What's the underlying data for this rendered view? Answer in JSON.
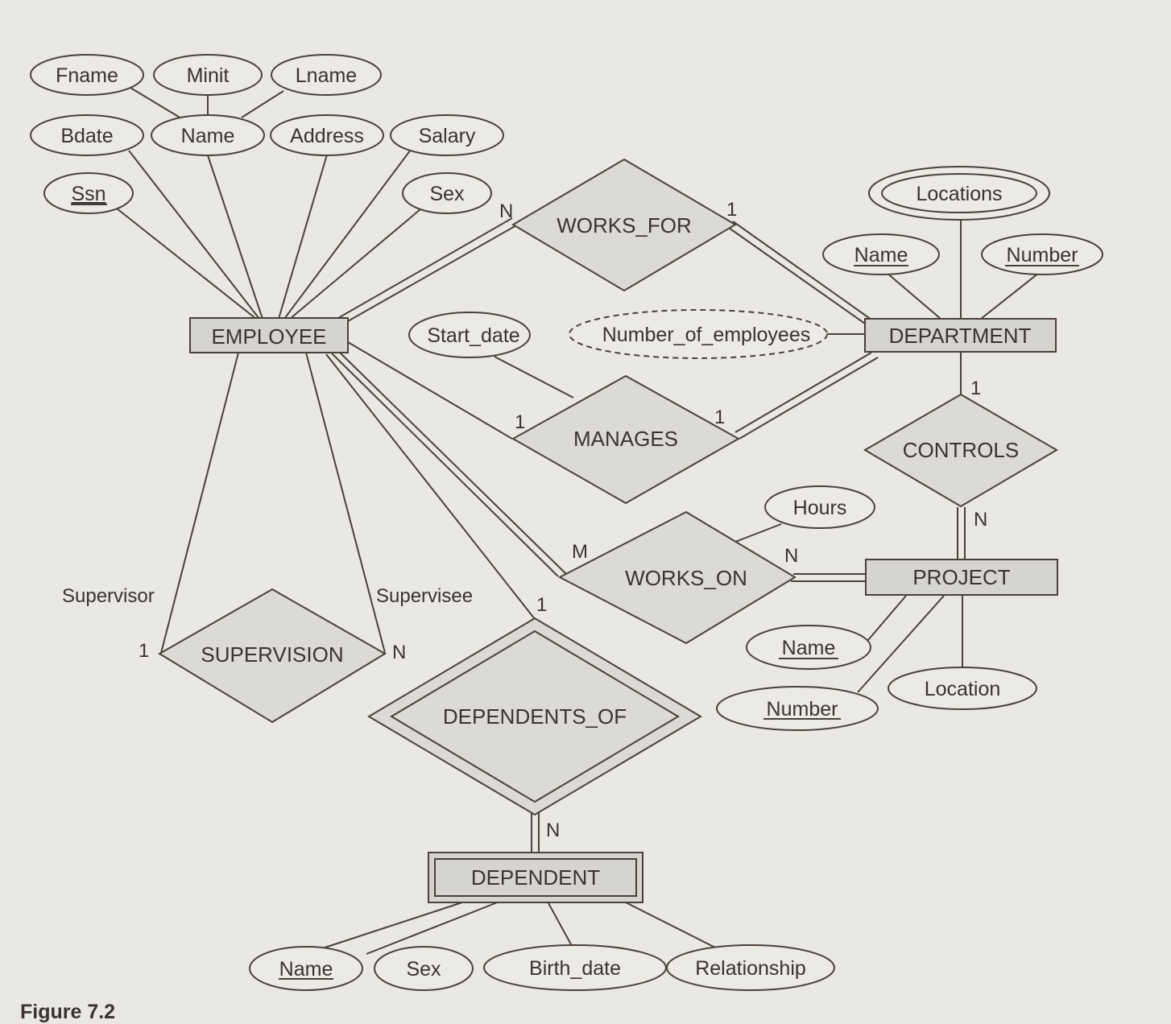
{
  "figure": {
    "caption": "Figure 7.2",
    "type": "ER diagram",
    "colors": {
      "background": "#e9e8e3",
      "ink": "#3a3330",
      "entity_fill": "#d6d4cf",
      "relationship_fill": "#dcdad5",
      "attribute_fill": "#eceae5"
    }
  },
  "entities": {
    "employee": {
      "label": "EMPLOYEE",
      "weak": false
    },
    "department": {
      "label": "DEPARTMENT",
      "weak": false
    },
    "project": {
      "label": "PROJECT",
      "weak": false
    },
    "dependent": {
      "label": "DEPENDENT",
      "weak": true
    }
  },
  "relationships": {
    "works_for": {
      "label": "WORKS_FOR",
      "identifying": false
    },
    "manages": {
      "label": "MANAGES",
      "identifying": false
    },
    "works_on": {
      "label": "WORKS_ON",
      "identifying": false
    },
    "controls": {
      "label": "CONTROLS",
      "identifying": false
    },
    "supervision": {
      "label": "SUPERVISION",
      "identifying": false
    },
    "dependents_of": {
      "label": "DEPENDENTS_OF",
      "identifying": true
    }
  },
  "attributes": {
    "employee": {
      "fname": {
        "label": "Fname",
        "key": false
      },
      "minit": {
        "label": "Minit",
        "key": false
      },
      "lname": {
        "label": "Lname",
        "key": false
      },
      "bdate": {
        "label": "Bdate",
        "key": false
      },
      "name": {
        "label": "Name",
        "key": false,
        "composite": true
      },
      "address": {
        "label": "Address",
        "key": false
      },
      "salary": {
        "label": "Salary",
        "key": false
      },
      "ssn": {
        "label": "Ssn",
        "key": true
      },
      "sex": {
        "label": "Sex",
        "key": false
      }
    },
    "department": {
      "locations": {
        "label": "Locations",
        "multivalued": true
      },
      "name": {
        "label": "Name",
        "key": true
      },
      "number": {
        "label": "Number",
        "key": true
      },
      "number_of_employees": {
        "label": "Number_of_employees",
        "derived": true
      }
    },
    "manages": {
      "start_date": {
        "label": "Start_date",
        "key": false
      }
    },
    "works_on": {
      "hours": {
        "label": "Hours",
        "key": false
      }
    },
    "project": {
      "name": {
        "label": "Name",
        "key": true
      },
      "number": {
        "label": "Number",
        "key": true
      },
      "location": {
        "label": "Location",
        "key": false
      }
    },
    "dependent": {
      "name": {
        "label": "Name",
        "key": true
      },
      "sex": {
        "label": "Sex",
        "key": false
      },
      "birth_date": {
        "label": "Birth_date",
        "key": false
      },
      "relationship": {
        "label": "Relationship",
        "key": false
      }
    }
  },
  "cardinalities": {
    "works_for_employee": "N",
    "works_for_department": "1",
    "manages_employee": "1",
    "manages_department": "1",
    "works_on_employee": "M",
    "works_on_project": "N",
    "controls_department": "1",
    "controls_project": "N",
    "supervision_supervisor": "1",
    "supervision_supervisee": "N",
    "dependents_of_employee": "1",
    "dependents_of_dependent": "N"
  },
  "roles": {
    "supervisor": "Supervisor",
    "supervisee": "Supervisee"
  }
}
